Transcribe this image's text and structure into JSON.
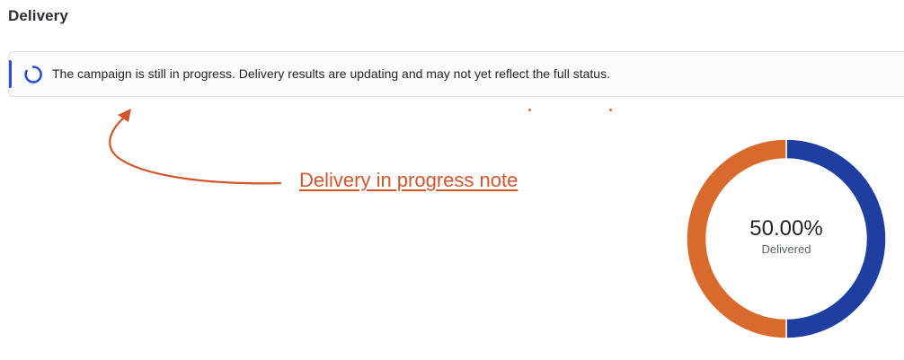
{
  "section": {
    "title": "Delivery"
  },
  "banner": {
    "icon": "loading-spinner-icon",
    "message": "The campaign is still in progress. Delivery results are updating and may not yet reflect the full status."
  },
  "annotation": {
    "label": "Delivery in progress note"
  },
  "chart_data": {
    "type": "pie",
    "series": [
      {
        "value": 50
      },
      {
        "value": 50
      }
    ],
    "center_value": "50.00%",
    "center_caption": "Delivered",
    "colors": [
      "#1f3fa0",
      "#d96a2e"
    ]
  },
  "colors": {
    "accent_blue": "#2e4fcf",
    "annotation_orange": "#d0562b"
  }
}
